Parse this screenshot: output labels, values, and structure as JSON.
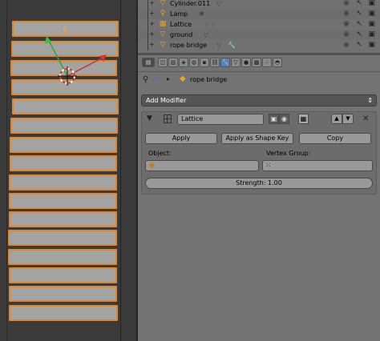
{
  "outliner": {
    "rows": [
      {
        "label": "Cylinder.011",
        "icon": "triangle-icon",
        "sub_icon": "mesh-data-icon"
      },
      {
        "label": "Lamp",
        "icon": "lamp-icon",
        "sub_icon": "lamp-data-icon"
      },
      {
        "label": "Lattice",
        "icon": "lattice-icon",
        "sub_icon": "lattice-data-icon"
      },
      {
        "label": "ground",
        "icon": "triangle-icon",
        "sub_icon": "mesh-data-icon"
      },
      {
        "label": "rope bridge",
        "icon": "triangle-icon",
        "sub_icon": "modifier-wrench-icon"
      }
    ]
  },
  "properties": {
    "tabs": [
      "render",
      "render-layers",
      "scene",
      "world",
      "object",
      "constraints",
      "modifiers",
      "data",
      "material",
      "texture",
      "particles",
      "physics"
    ],
    "active_tab": "modifiers"
  },
  "breadcrumb": {
    "object": "rope bridge"
  },
  "add_modifier": {
    "label": "Add Modifier"
  },
  "modifier": {
    "name": "Lattice",
    "apply": "Apply",
    "apply_shape": "Apply as Shape Key",
    "copy": "Copy",
    "object_label": "Object:",
    "vertex_group_label": "Vertex Group:",
    "object_value": "",
    "vertex_group_value": "",
    "strength": "Strength: 1.00"
  },
  "colors": {
    "accent_active": "#5680c2",
    "selection_outline": "#e2862a",
    "viewport_bg": "#3a3a3a",
    "panel_bg": "#727272"
  }
}
